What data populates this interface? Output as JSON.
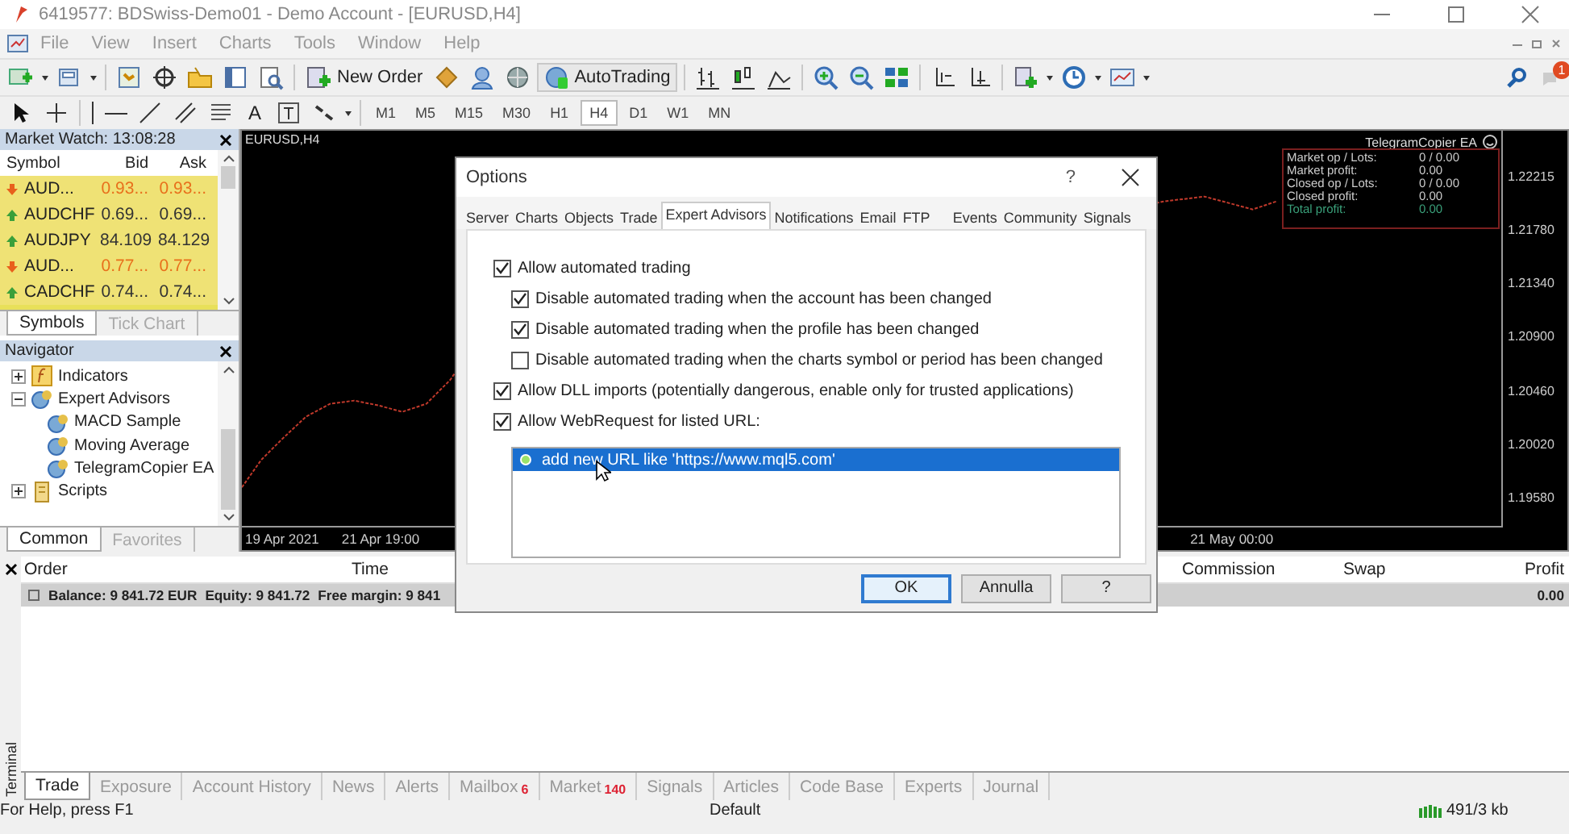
{
  "window": {
    "title": "6419577: BDSwiss-Demo01 - Demo Account - [EURUSD,H4]"
  },
  "menu": [
    "File",
    "View",
    "Insert",
    "Charts",
    "Tools",
    "Window",
    "Help"
  ],
  "toolbar": {
    "new_order": "New Order",
    "autotrading": "AutoTrading",
    "notification_badge": "1",
    "text_tool": "A"
  },
  "timeframes": [
    {
      "label": "M1",
      "selected": false
    },
    {
      "label": "M5",
      "selected": false
    },
    {
      "label": "M15",
      "selected": false
    },
    {
      "label": "M30",
      "selected": false
    },
    {
      "label": "H1",
      "selected": false
    },
    {
      "label": "H4",
      "selected": true
    },
    {
      "label": "D1",
      "selected": false
    },
    {
      "label": "W1",
      "selected": false
    },
    {
      "label": "MN",
      "selected": false
    }
  ],
  "market_watch": {
    "title": "Market Watch: 13:08:28",
    "columns": [
      "Symbol",
      "Bid",
      "Ask"
    ],
    "rows": [
      {
        "symbol": "AUD...",
        "bid": "0.93...",
        "ask": "0.93...",
        "rising": false
      },
      {
        "symbol": "AUDCHF",
        "bid": "0.69...",
        "ask": "0.69...",
        "rising": true
      },
      {
        "symbol": "AUDJPY",
        "bid": "84.109",
        "ask": "84.129",
        "rising": true
      },
      {
        "symbol": "AUD...",
        "bid": "0.77...",
        "ask": "0.77...",
        "rising": false
      },
      {
        "symbol": "CADCHF",
        "bid": "0.74...",
        "ask": "0.74...",
        "rising": true
      }
    ],
    "tabs": [
      {
        "label": "Symbols",
        "selected": true
      },
      {
        "label": "Tick Chart",
        "selected": false
      }
    ]
  },
  "navigator": {
    "title": "Navigator",
    "items": [
      {
        "label": "Indicators",
        "kind": "indicators",
        "expanded": false
      },
      {
        "label": "Expert Advisors",
        "kind": "experts",
        "expanded": true,
        "children": [
          {
            "label": "MACD Sample"
          },
          {
            "label": "Moving Average"
          },
          {
            "label": "TelegramCopier EA"
          }
        ]
      },
      {
        "label": "Scripts",
        "kind": "scripts",
        "expanded": false
      }
    ],
    "tabs": [
      {
        "label": "Common",
        "selected": true
      },
      {
        "label": "Favorites",
        "selected": false
      }
    ]
  },
  "chart": {
    "title": "EURUSD,H4",
    "price_labels": [
      "1.22215",
      "1.21780",
      "1.21340",
      "1.20900",
      "1.20460",
      "1.20020",
      "1.19580"
    ],
    "time_labels": [
      "19 Apr 2021",
      "21 Apr 19:00",
      "21 May 00:00"
    ],
    "ea_panel": {
      "title": "TelegramCopier EA",
      "rows": [
        {
          "label": "Market op / Lots:",
          "value": "0 / 0.00",
          "highlight": false
        },
        {
          "label": "Market profit:",
          "value": "0.00",
          "highlight": false
        },
        {
          "label": "Closed op / Lots:",
          "value": "0 / 0.00",
          "highlight": false
        },
        {
          "label": "Closed profit:",
          "value": "0.00",
          "highlight": false
        },
        {
          "label": "Total profit:",
          "value": "0.00",
          "highlight": true
        }
      ]
    }
  },
  "dialog": {
    "title": "Options",
    "help": "?",
    "tabs": [
      {
        "label": "Server",
        "selected": false
      },
      {
        "label": "Charts",
        "selected": false
      },
      {
        "label": "Objects",
        "selected": false
      },
      {
        "label": "Trade",
        "selected": false
      },
      {
        "label": "Expert Advisors",
        "selected": true
      },
      {
        "label": "Notifications",
        "selected": false
      },
      {
        "label": "Email",
        "selected": false
      },
      {
        "label": "FTP",
        "selected": false
      },
      {
        "label": "Events",
        "selected": false
      },
      {
        "label": "Community",
        "selected": false
      },
      {
        "label": "Signals",
        "selected": false
      }
    ],
    "options": [
      {
        "label": "Allow automated trading",
        "checked": true,
        "children": [
          {
            "label": "Disable automated trading when the account has been changed",
            "checked": true
          },
          {
            "label": "Disable automated trading when the profile has been changed",
            "checked": true
          },
          {
            "label": "Disable automated trading when the charts symbol or period has been changed",
            "checked": false
          }
        ]
      },
      {
        "label": "Allow DLL imports (potentially dangerous, enable only for trusted applications)",
        "checked": true
      },
      {
        "label": "Allow WebRequest for listed URL:",
        "checked": true
      }
    ],
    "urls": [
      {
        "text": "add new URL like 'https://www.mql5.com'",
        "selected": true
      }
    ],
    "buttons": [
      {
        "label": "OK",
        "default": true
      },
      {
        "label": "Annulla",
        "default": false
      },
      {
        "label": "?",
        "default": false
      }
    ]
  },
  "terminal": {
    "label": "Terminal",
    "columns": [
      "Order",
      "Time",
      "Commission",
      "Swap",
      "Profit"
    ],
    "balance": [
      "Balance: 9 841.72 EUR",
      "Equity: 9 841.72",
      "Free margin: 9 841"
    ],
    "profit": "0.00",
    "tabs": [
      {
        "label": "Trade",
        "selected": true
      },
      {
        "label": "Exposure",
        "selected": false
      },
      {
        "label": "Account History",
        "selected": false
      },
      {
        "label": "News",
        "selected": false
      },
      {
        "label": "Alerts",
        "selected": false
      },
      {
        "label": "Mailbox",
        "badge": "6",
        "selected": false
      },
      {
        "label": "Market",
        "badge": "140",
        "selected": false
      },
      {
        "label": "Signals",
        "selected": false
      },
      {
        "label": "Articles",
        "selected": false
      },
      {
        "label": "Code Base",
        "selected": false
      },
      {
        "label": "Experts",
        "selected": false
      },
      {
        "label": "Journal",
        "selected": false
      }
    ]
  },
  "status_bar": [
    "For Help, press F1",
    "Default",
    "491/3 kb"
  ]
}
